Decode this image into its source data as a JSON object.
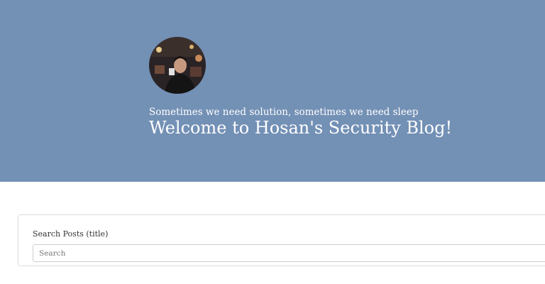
{
  "hero": {
    "avatar_icon": "profile-photo",
    "tagline": "Sometimes we need solution, sometimes we need sleep",
    "title": "Welcome to Hosan's Security Blog!",
    "background_color": "#7390b5"
  },
  "search": {
    "label": "Search Posts (title)",
    "placeholder": "Search",
    "value": ""
  }
}
